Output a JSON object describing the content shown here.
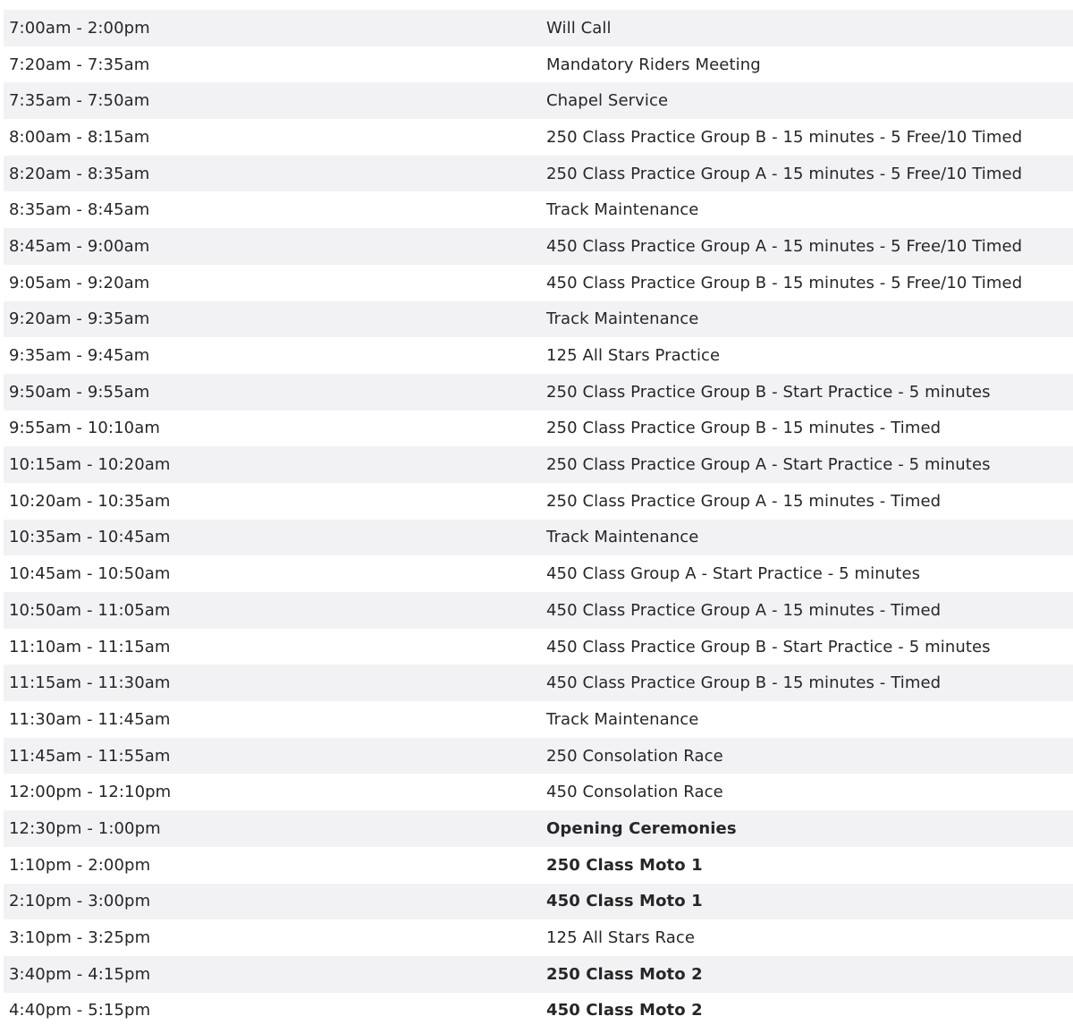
{
  "schedule": [
    {
      "time": "7:00am - 2:00pm",
      "event": "Will Call",
      "bold": false
    },
    {
      "time": "7:20am - 7:35am",
      "event": "Mandatory Riders Meeting",
      "bold": false
    },
    {
      "time": "7:35am - 7:50am",
      "event": "Chapel Service",
      "bold": false
    },
    {
      "time": "8:00am - 8:15am",
      "event": "250 Class Practice Group B - 15 minutes - 5 Free/10 Timed",
      "bold": false
    },
    {
      "time": "8:20am - 8:35am",
      "event": "250 Class Practice Group A - 15 minutes - 5 Free/10 Timed",
      "bold": false
    },
    {
      "time": "8:35am - 8:45am",
      "event": "Track Maintenance",
      "bold": false
    },
    {
      "time": "8:45am - 9:00am",
      "event": "450 Class Practice Group A - 15 minutes - 5 Free/10 Timed",
      "bold": false
    },
    {
      "time": "9:05am - 9:20am",
      "event": "450 Class Practice Group B - 15 minutes - 5 Free/10 Timed",
      "bold": false
    },
    {
      "time": "9:20am - 9:35am",
      "event": "Track Maintenance",
      "bold": false
    },
    {
      "time": "9:35am - 9:45am",
      "event": "125 All Stars Practice",
      "bold": false
    },
    {
      "time": "9:50am - 9:55am",
      "event": "250 Class Practice Group B - Start Practice - 5 minutes",
      "bold": false
    },
    {
      "time": "9:55am - 10:10am",
      "event": "250 Class Practice Group B - 15 minutes - Timed",
      "bold": false
    },
    {
      "time": "10:15am - 10:20am",
      "event": "250 Class Practice Group A - Start Practice - 5 minutes",
      "bold": false
    },
    {
      "time": "10:20am - 10:35am",
      "event": "250 Class Practice Group A - 15 minutes - Timed",
      "bold": false
    },
    {
      "time": "10:35am - 10:45am",
      "event": "Track Maintenance",
      "bold": false
    },
    {
      "time": "10:45am - 10:50am",
      "event": "450 Class Group A - Start Practice - 5 minutes",
      "bold": false
    },
    {
      "time": "10:50am - 11:05am",
      "event": "450 Class Practice Group A - 15 minutes - Timed",
      "bold": false
    },
    {
      "time": "11:10am - 11:15am",
      "event": "450 Class Practice Group B - Start Practice - 5 minutes",
      "bold": false
    },
    {
      "time": "11:15am - 11:30am",
      "event": "450 Class Practice Group B - 15 minutes - Timed",
      "bold": false
    },
    {
      "time": "11:30am - 11:45am",
      "event": "Track Maintenance",
      "bold": false
    },
    {
      "time": "11:45am - 11:55am",
      "event": "250 Consolation Race",
      "bold": false
    },
    {
      "time": "12:00pm - 12:10pm",
      "event": "450 Consolation Race",
      "bold": false
    },
    {
      "time": "12:30pm - 1:00pm",
      "event": "Opening Ceremonies",
      "bold": true
    },
    {
      "time": "1:10pm - 2:00pm",
      "event": "250 Class Moto 1",
      "bold": true
    },
    {
      "time": "2:10pm - 3:00pm",
      "event": "450 Class Moto 1",
      "bold": true
    },
    {
      "time": "3:10pm - 3:25pm",
      "event": "125 All Stars Race",
      "bold": false
    },
    {
      "time": "3:40pm - 4:15pm",
      "event": "250 Class Moto 2",
      "bold": true
    },
    {
      "time": "4:40pm - 5:15pm",
      "event": "450 Class Moto 2",
      "bold": true
    }
  ],
  "colors": {
    "row_shade": "#f2f2f4",
    "text": "#262626"
  }
}
